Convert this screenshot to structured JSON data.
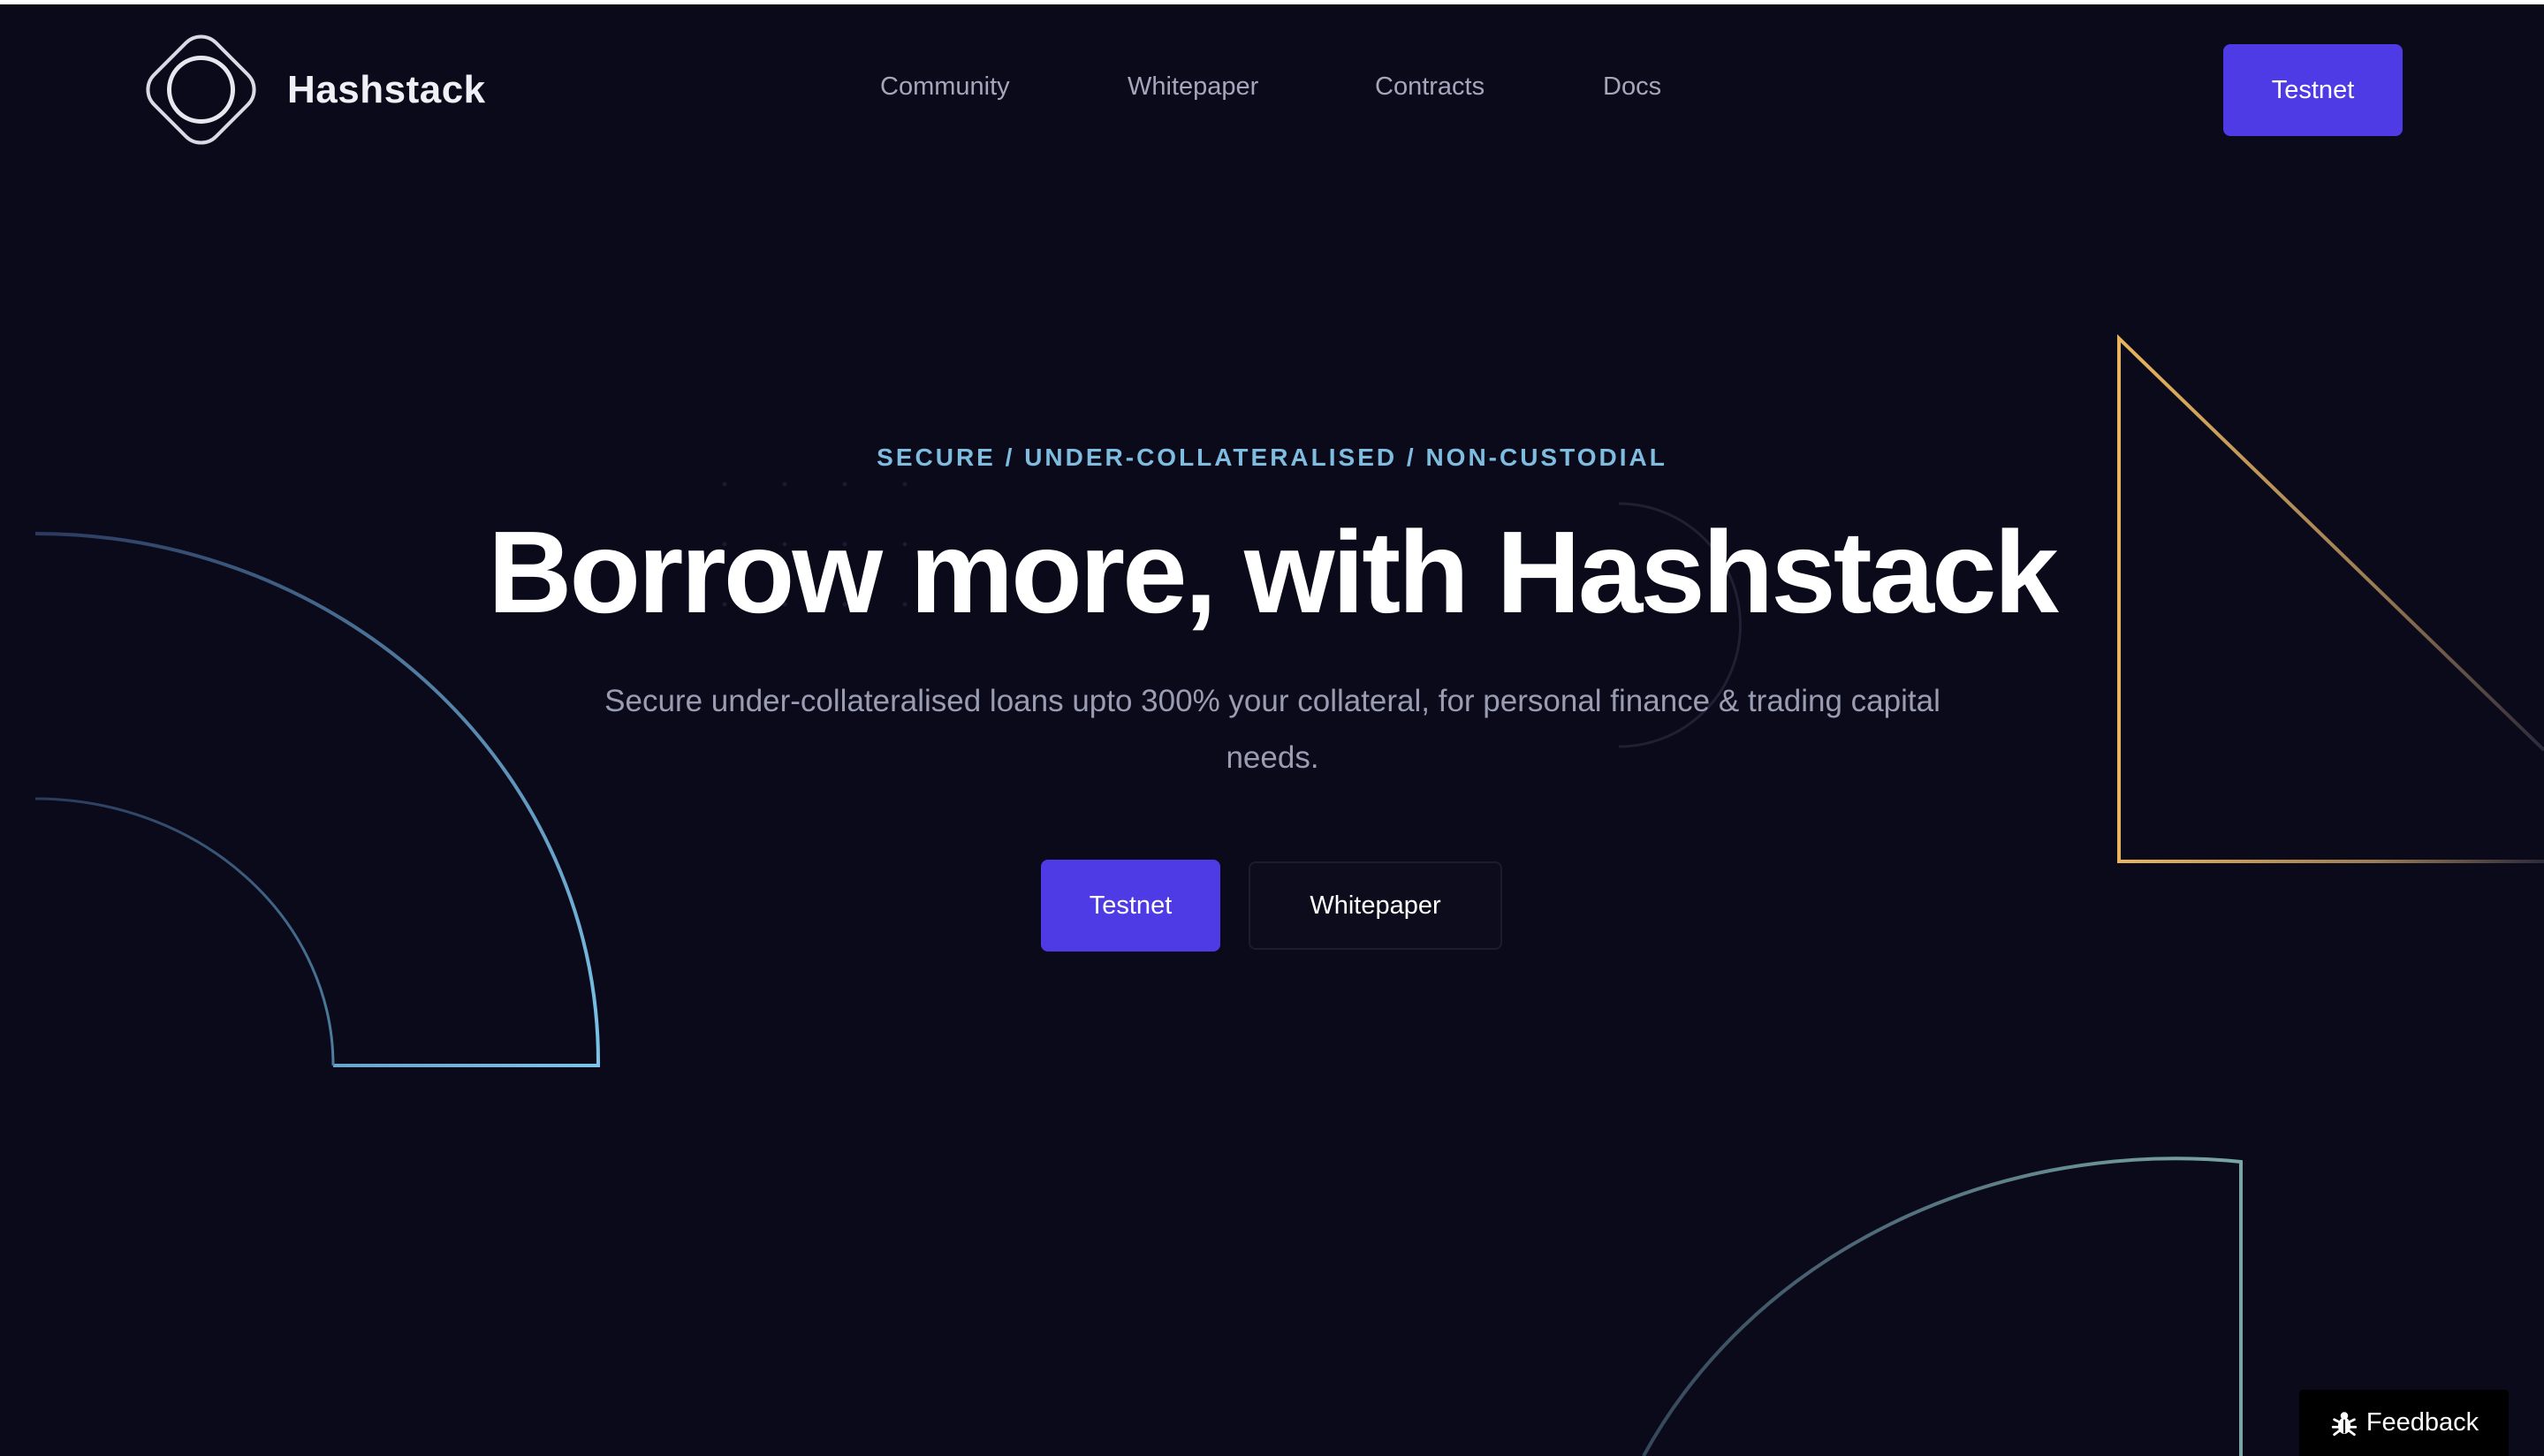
{
  "brand": {
    "name": "Hashstack",
    "logo_icon": "hashstack-logo-icon"
  },
  "nav": {
    "items": [
      {
        "label": "Community"
      },
      {
        "label": "Whitepaper"
      },
      {
        "label": "Contracts"
      },
      {
        "label": "Docs"
      }
    ],
    "cta_label": "Testnet"
  },
  "hero": {
    "eyebrow": "SECURE / UNDER-COLLATERALISED / NON-CUSTODIAL",
    "headline": "Borrow more, with Hashstack",
    "subtext": "Secure under-collateralised loans upto 300% your collateral, for personal finance & trading capital needs.",
    "primary_cta": "Testnet",
    "secondary_cta": "Whitepaper"
  },
  "feedback": {
    "label": "Feedback",
    "icon": "bug-icon"
  },
  "colors": {
    "background": "#0a0a1b",
    "accent": "#4f3be5",
    "eyebrow": "#7fbde0",
    "text_muted": "#9a9db2",
    "shape_blue": "#7cc4ea",
    "shape_gold": "#e9b45d",
    "shape_teal": "#7aa6a8"
  }
}
